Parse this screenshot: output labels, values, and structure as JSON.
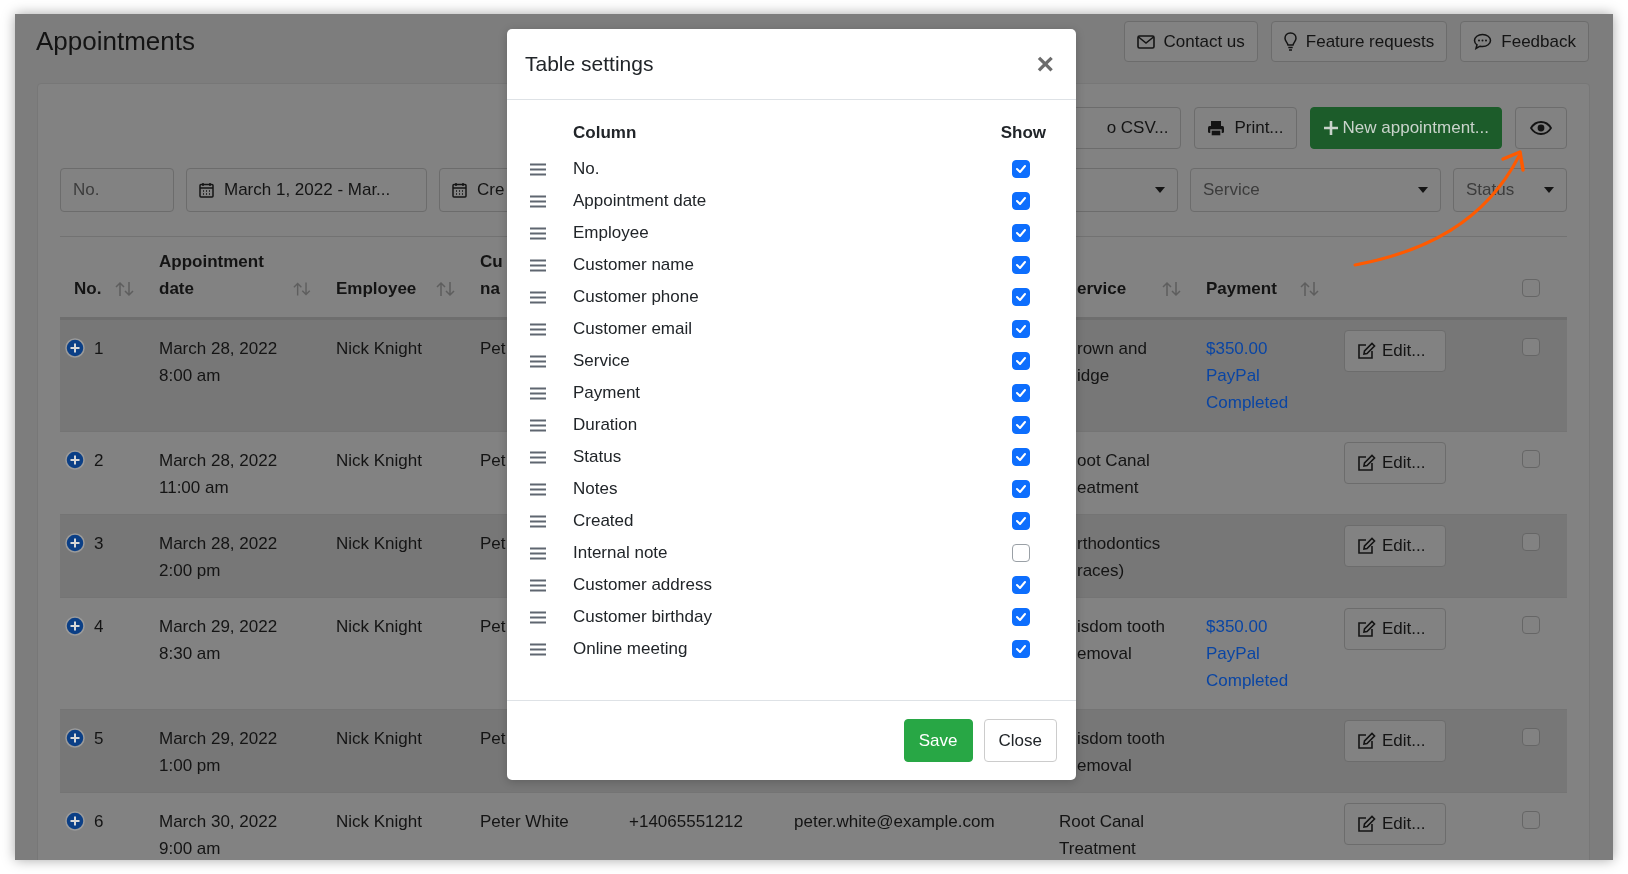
{
  "page": {
    "title": "Appointments"
  },
  "header_buttons": [
    {
      "label": "Contact us"
    },
    {
      "label": "Feature requests"
    },
    {
      "label": "Feedback"
    }
  ],
  "toolbar": {
    "export_button": "o CSV...",
    "print_button": "Print...",
    "new_button": "New appointment..."
  },
  "filters": [
    {
      "kind": "text",
      "placeholder": "No."
    },
    {
      "kind": "date",
      "value": "March 1, 2022 - Mar..."
    },
    {
      "kind": "date",
      "value": "Cre"
    },
    {
      "kind": "select"
    },
    {
      "kind": "select",
      "placeholder": "Service"
    },
    {
      "kind": "select",
      "placeholder": "Status"
    }
  ],
  "table": {
    "columns": [
      {
        "label": "No.",
        "sortable": true
      },
      {
        "label": "Appointment date",
        "sortable": true
      },
      {
        "label": "Employee",
        "sortable": true
      },
      {
        "label": "Cu na",
        "sortable": false
      },
      {
        "label": "ervice",
        "sortable": true
      },
      {
        "label": "Payment",
        "sortable": true
      }
    ],
    "select_all_checked": false,
    "rows": [
      {
        "no": "1",
        "date": "March 28, 2022\n8:00 am",
        "employee": "Nick Knight",
        "customer": "Pet",
        "service": "rown and\nidge",
        "payment": [
          "$350.00",
          "PayPal",
          "Completed"
        ],
        "edit": "Edit...",
        "checked": false
      },
      {
        "no": "2",
        "date": "March 28, 2022\n11:00 am",
        "employee": "Nick Knight",
        "customer": "Pet",
        "service": "oot Canal\neatment",
        "edit": "Edit...",
        "checked": false
      },
      {
        "no": "3",
        "date": "March 28, 2022\n2:00 pm",
        "employee": "Nick Knight",
        "customer": "Pet",
        "service": "rthodontics\nraces)",
        "edit": "Edit...",
        "checked": false
      },
      {
        "no": "4",
        "date": "March 29, 2022\n8:30 am",
        "employee": "Nick Knight",
        "customer": "Pet",
        "service": "isdom tooth\nemoval",
        "payment": [
          "$350.00",
          "PayPal",
          "Completed"
        ],
        "edit": "Edit...",
        "checked": false
      },
      {
        "no": "5",
        "date": "March 29, 2022\n1:00 pm",
        "employee": "Nick Knight",
        "customer": "Pet",
        "service": "isdom tooth\nemoval",
        "edit": "Edit...",
        "checked": false
      },
      {
        "no": "6",
        "date": "March 30, 2022\n9:00 am",
        "employee": "Nick Knight",
        "customer": "Peter White",
        "phone": "+14065551212",
        "email": "peter.white@example.com",
        "service": "Root Canal\nTreatment",
        "edit": "Edit...",
        "checked": false
      }
    ]
  },
  "modal": {
    "title": "Table settings",
    "close_symbol": "×",
    "column_header": "Column",
    "show_header": "Show",
    "columns": [
      {
        "label": "No.",
        "checked": true
      },
      {
        "label": "Appointment date",
        "checked": true
      },
      {
        "label": "Employee",
        "checked": true
      },
      {
        "label": "Customer name",
        "checked": true
      },
      {
        "label": "Customer phone",
        "checked": true
      },
      {
        "label": "Customer email",
        "checked": true
      },
      {
        "label": "Service",
        "checked": true
      },
      {
        "label": "Payment",
        "checked": true
      },
      {
        "label": "Duration",
        "checked": true
      },
      {
        "label": "Status",
        "checked": true
      },
      {
        "label": "Notes",
        "checked": true
      },
      {
        "label": "Created",
        "checked": true
      },
      {
        "label": "Internal note",
        "checked": false
      },
      {
        "label": "Customer address",
        "checked": true
      },
      {
        "label": "Customer birthday",
        "checked": true
      },
      {
        "label": "Online meeting",
        "checked": true
      }
    ],
    "save_button": "Save",
    "close_button": "Close"
  }
}
